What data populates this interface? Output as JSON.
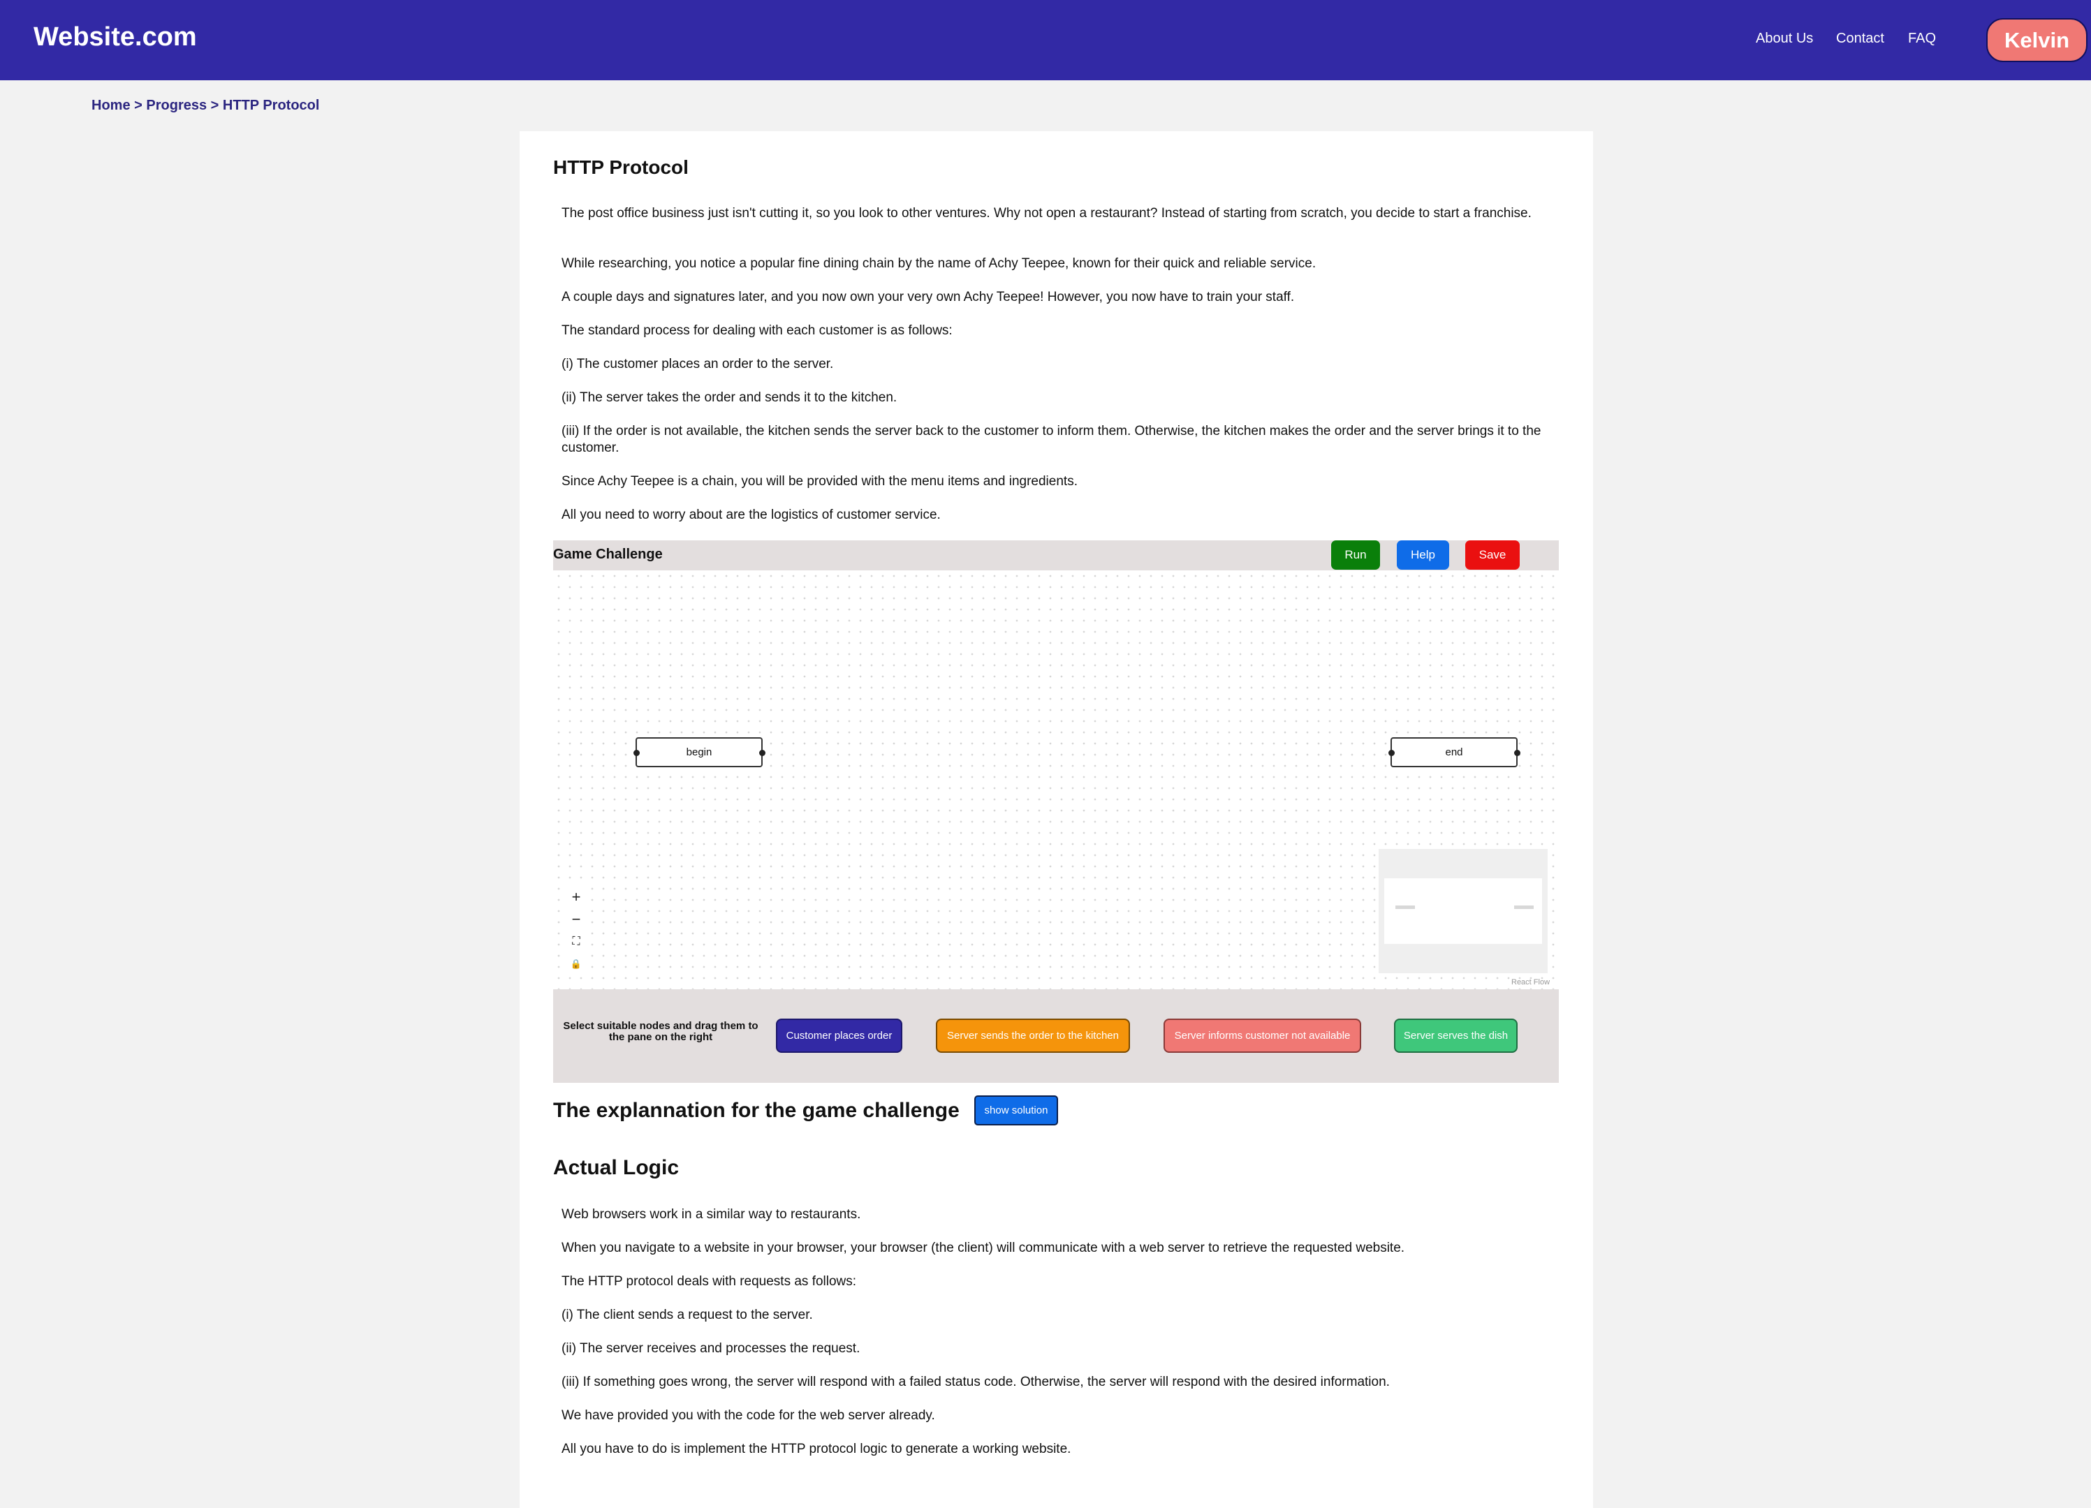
{
  "header": {
    "brand": "Website.com",
    "nav": [
      "About Us",
      "Contact",
      "FAQ"
    ],
    "user": "Kelvin",
    "bg_color": "#3229a5"
  },
  "breadcrumb": {
    "home": "Home",
    "sep": ">",
    "progress": "Progress",
    "current": "HTTP Protocol"
  },
  "page_title": "HTTP Protocol",
  "intro": [
    "The post office business just isn't cutting it, so you look to other ventures. Why not open a restaurant? Instead of starting from scratch, you decide to start a franchise.",
    "While researching, you notice a popular fine dining chain by the name of Achy Teepee, known for their quick and reliable service.",
    "A couple days and signatures later, and you now own your very own Achy Teepee! However, you now have to train your staff.",
    "The standard process for dealing with each customer is as follows:",
    "(i) The customer places an order to the server.",
    "(ii) The server takes the order and sends it to the kitchen.",
    "(iii) If the order is not available, the kitchen sends the server back to the customer to inform them. Otherwise, the kitchen makes the order and the server brings it to the customer.",
    "Since Achy Teepee is a chain, you will be provided with the menu items and ingredients.",
    "All you need to worry about are the logistics of customer service."
  ],
  "game": {
    "title": "Game Challenge",
    "buttons": {
      "run": "Run",
      "help": "Help",
      "save": "Save"
    },
    "canvas_nodes": {
      "begin": "begin",
      "end": "end"
    },
    "controls": {
      "zoom_in": "+",
      "zoom_out": "−",
      "fit": "⛶",
      "lock": "🔒"
    },
    "attribution": "React Flow",
    "instruction": "Select suitable nodes and drag them to the pane on the right",
    "palette": [
      {
        "label": "Customer places order",
        "color": "#3229a5"
      },
      {
        "label": "Server sends the order to the kitchen",
        "color": "#f5940b"
      },
      {
        "label": "Server informs customer not available",
        "color": "#f07874"
      },
      {
        "label": "Server serves the dish",
        "color": "#3fc77b"
      }
    ]
  },
  "explanation": {
    "title": "The explannation for the game challenge",
    "show_solution": "show solution"
  },
  "logic": {
    "title": "Actual Logic",
    "paragraphs": [
      "Web browsers work in a similar way to restaurants.",
      "When you navigate to a website in your browser, your browser (the client) will communicate with a web server to retrieve the requested website.",
      "The HTTP protocol deals with requests as follows:",
      "(i) The client sends a request to the server.",
      "(ii) The server receives and processes the request.",
      "(iii) If something goes wrong, the server will respond with a failed status code. Otherwise, the server will respond with the desired information.",
      "We have provided you with the code for the web server already.",
      "All you have to do is implement the HTTP protocol logic to generate a working website."
    ]
  }
}
